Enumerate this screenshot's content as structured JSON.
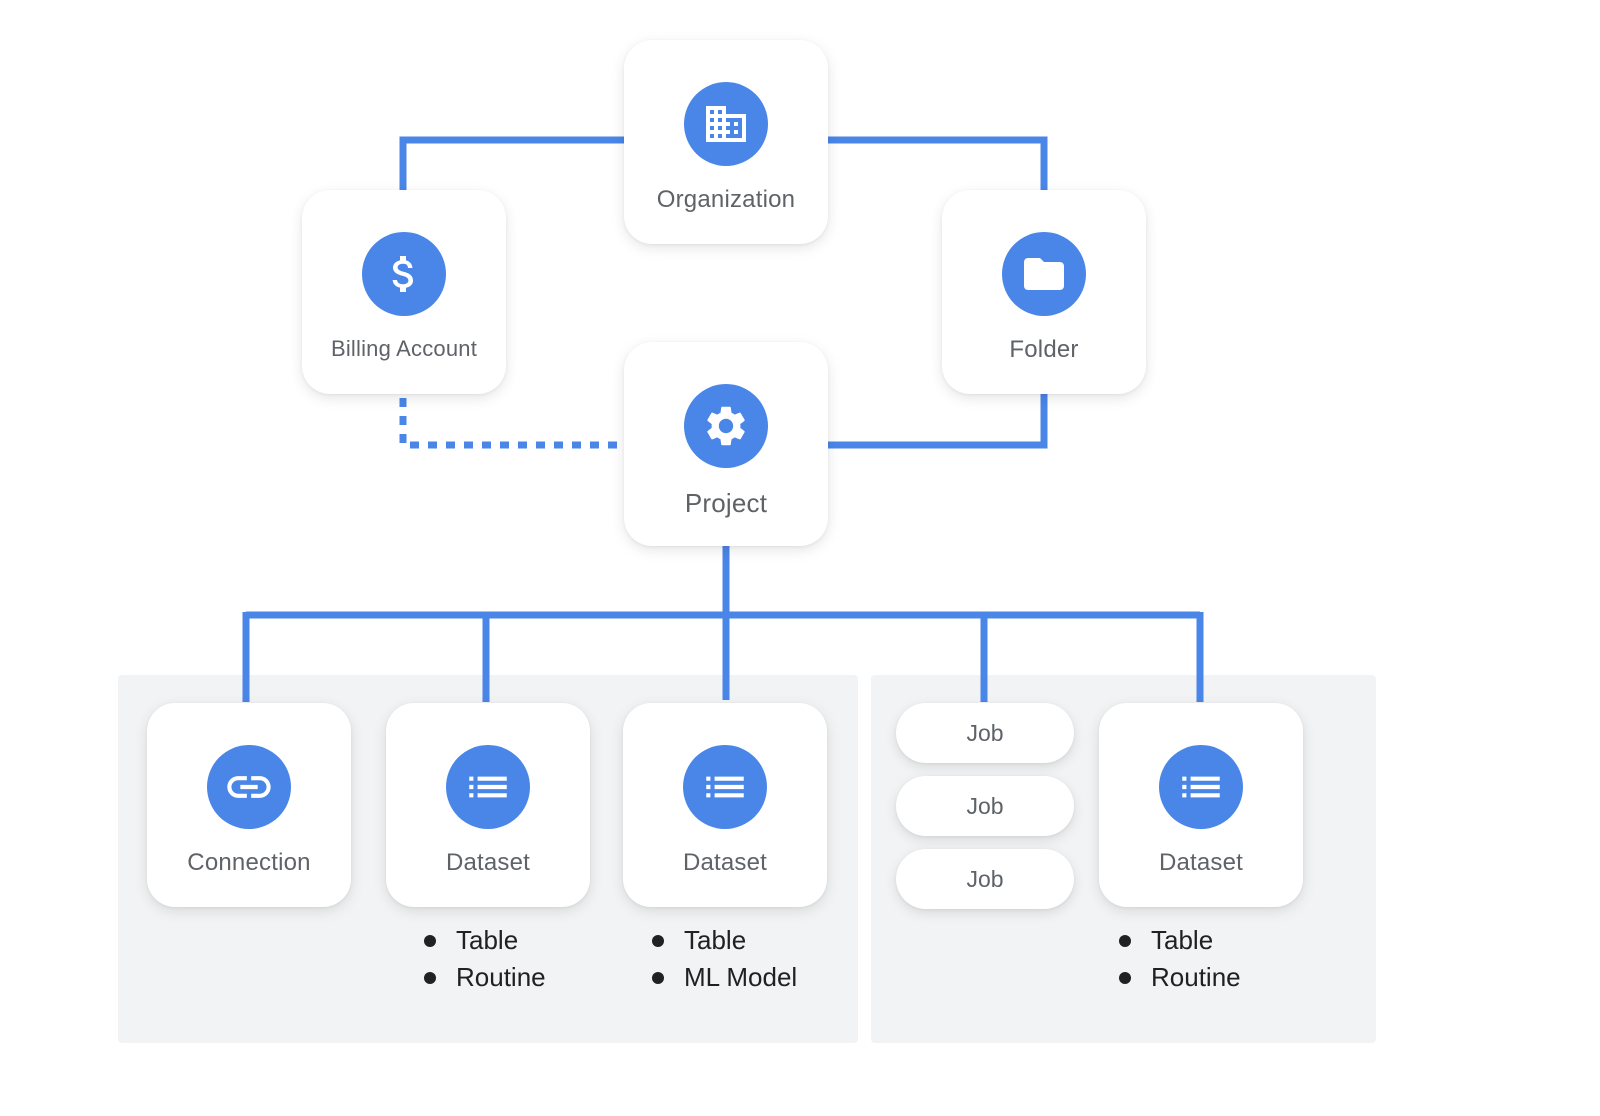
{
  "colors": {
    "accent": "#4a86e8",
    "panel": "#f1f3f4",
    "label": "#5f6368",
    "text": "#202124"
  },
  "nodes": {
    "organization": {
      "label": "Organization",
      "icon": "building-icon"
    },
    "billing": {
      "label": "Billing Account",
      "icon": "dollar-icon"
    },
    "folder": {
      "label": "Folder",
      "icon": "folder-icon"
    },
    "project": {
      "label": "Project",
      "icon": "gear-icon"
    },
    "connection": {
      "label": "Connection",
      "icon": "link-icon"
    },
    "dataset1": {
      "label": "Dataset",
      "icon": "list-icon",
      "items": [
        "Table",
        "Routine"
      ]
    },
    "dataset2": {
      "label": "Dataset",
      "icon": "list-icon",
      "items": [
        "Table",
        "ML Model"
      ]
    },
    "dataset3": {
      "label": "Dataset",
      "icon": "list-icon",
      "items": [
        "Table",
        "Routine"
      ]
    }
  },
  "jobs": [
    "Job",
    "Job",
    "Job"
  ],
  "edges": [
    {
      "from": "Organization",
      "to": "Billing Account",
      "style": "solid"
    },
    {
      "from": "Organization",
      "to": "Folder",
      "style": "solid"
    },
    {
      "from": "Folder",
      "to": "Project",
      "style": "solid"
    },
    {
      "from": "Billing Account",
      "to": "Project",
      "style": "dotted"
    },
    {
      "from": "Project",
      "to": "Connection",
      "style": "solid"
    },
    {
      "from": "Project",
      "to": "Dataset",
      "style": "solid"
    },
    {
      "from": "Project",
      "to": "Dataset",
      "style": "solid"
    },
    {
      "from": "Project",
      "to": "Job",
      "style": "solid"
    },
    {
      "from": "Project",
      "to": "Dataset",
      "style": "solid"
    }
  ]
}
